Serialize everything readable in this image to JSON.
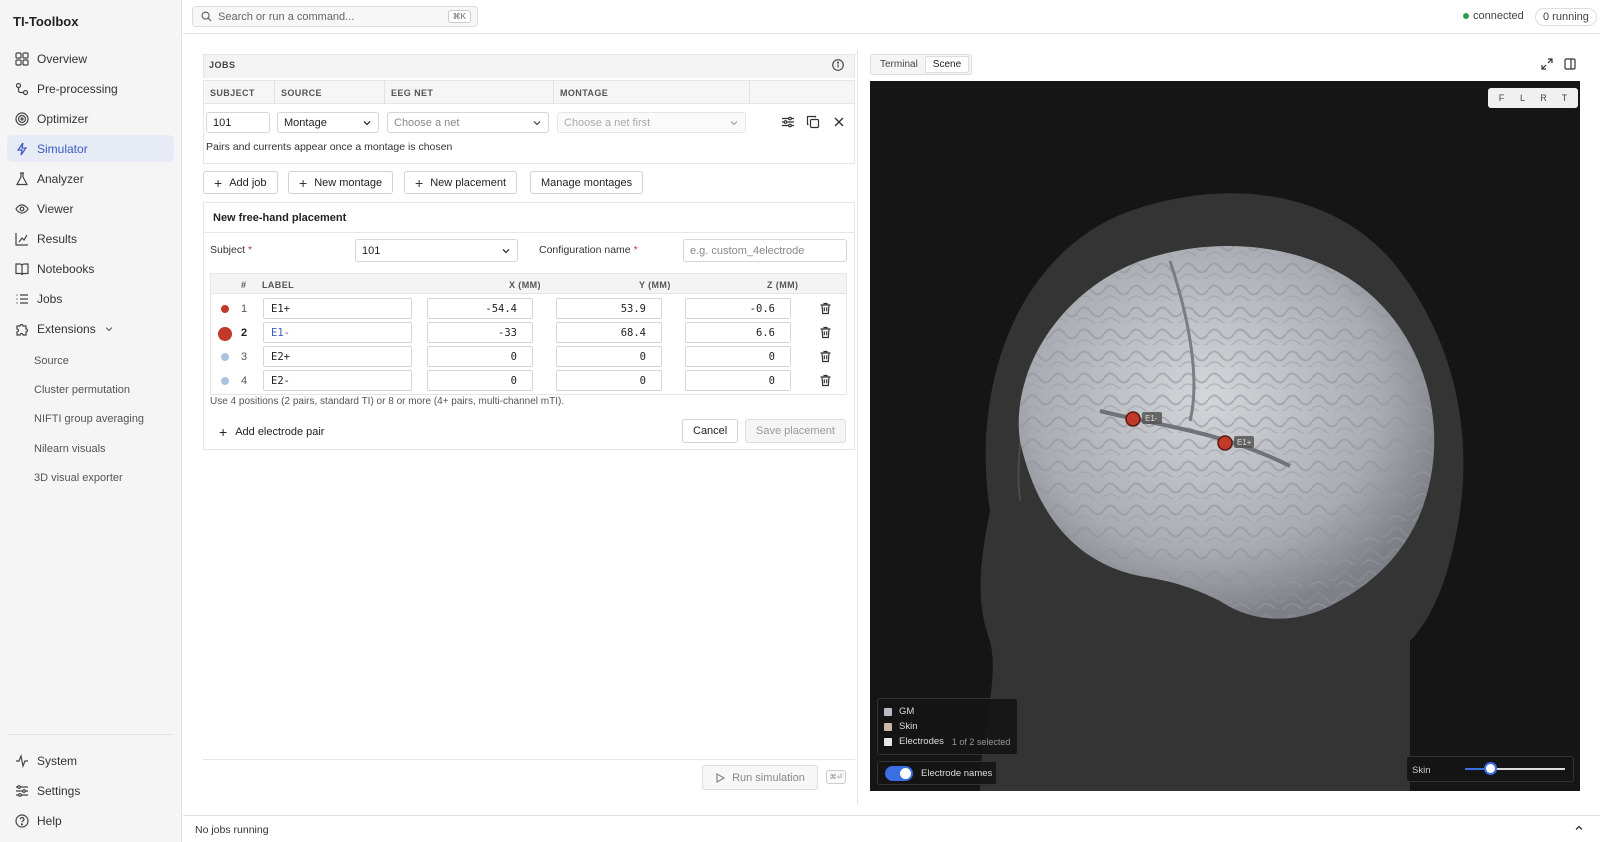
{
  "app": {
    "title": "TI-Toolbox"
  },
  "sidebar": {
    "items": [
      {
        "label": "Overview",
        "icon": "grid-icon"
      },
      {
        "label": "Pre-processing",
        "icon": "workflow-icon"
      },
      {
        "label": "Optimizer",
        "icon": "target-icon"
      },
      {
        "label": "Simulator",
        "icon": "bolt-icon",
        "active": true
      },
      {
        "label": "Analyzer",
        "icon": "flask-icon"
      },
      {
        "label": "Viewer",
        "icon": "eye-icon"
      },
      {
        "label": "Results",
        "icon": "chart-icon"
      },
      {
        "label": "Notebooks",
        "icon": "book-icon"
      },
      {
        "label": "Jobs",
        "icon": "list-icon"
      },
      {
        "label": "Extensions",
        "icon": "puzzle-icon"
      }
    ],
    "extensions": [
      "Source",
      "Cluster permutation",
      "NIFTI group averaging",
      "Nilearn visuals",
      "3D visual exporter"
    ],
    "footer": [
      {
        "label": "System",
        "icon": "activity-icon"
      },
      {
        "label": "Settings",
        "icon": "sliders-icon"
      },
      {
        "label": "Help",
        "icon": "help-icon"
      }
    ]
  },
  "topbar": {
    "search_placeholder": "Search or run a command...",
    "search_shortcut": "⌘K",
    "status": "connected",
    "running": "0 running"
  },
  "jobs": {
    "title": "JOBS",
    "columns": [
      "SUBJECT",
      "SOURCE",
      "EEG NET",
      "MONTAGE"
    ],
    "row": {
      "subject": "101",
      "source": "Montage",
      "eeg_net_placeholder": "Choose a net",
      "montage_placeholder": "Choose a net first"
    },
    "hint": "Pairs and currents appear once a montage is chosen"
  },
  "actions": {
    "add_job": "Add job",
    "new_montage": "New montage",
    "new_placement": "New placement",
    "manage_montages": "Manage montages"
  },
  "placement": {
    "title": "New free-hand placement",
    "subject_label": "Subject",
    "subject_value": "101",
    "config_label": "Configuration name",
    "config_placeholder": "e.g. custom_4electrode",
    "table_headers": [
      "#",
      "LABEL",
      "X (MM)",
      "Y (MM)",
      "Z (MM)"
    ],
    "rows": [
      {
        "num": "1",
        "label": "E1+",
        "x": "-54.4",
        "y": "53.9",
        "z": "-0.6",
        "color": "#c0392b"
      },
      {
        "num": "2",
        "label": "E1-",
        "x": "-33",
        "y": "68.4",
        "z": "6.6",
        "color": "#c0392b",
        "selected": true
      },
      {
        "num": "3",
        "label": "E2+",
        "x": "0",
        "y": "0",
        "z": "0",
        "color": "#a9c4e0"
      },
      {
        "num": "4",
        "label": "E2-",
        "x": "0",
        "y": "0",
        "z": "0",
        "color": "#a9c4e0"
      }
    ],
    "hint": "Use 4 positions (2 pairs, standard TI) or 8 or more (4+ pairs, multi-channel mTI).",
    "add_pair": "Add electrode pair",
    "cancel": "Cancel",
    "save": "Save placement"
  },
  "run": {
    "label": "Run simulation",
    "shortcut": "⌘⏎"
  },
  "viewer": {
    "tabs": [
      "Terminal",
      "Scene"
    ],
    "active_tab": "Scene",
    "view_buttons": [
      "F",
      "L",
      "R",
      "T"
    ],
    "electrode_labels": [
      "E1-",
      "E1+"
    ],
    "legend": [
      {
        "label": "GM",
        "color": "#b8bcc4"
      },
      {
        "label": "Skin",
        "color": "#c9b8a8"
      },
      {
        "label": "Electrodes",
        "color": "#e8e8e8",
        "sub": "1 of 2 selected"
      }
    ],
    "names_toggle": "Electrode names",
    "names_toggle_on": true,
    "skin_label": "Skin",
    "skin_opacity": 0.26
  },
  "statusbar": {
    "text": "No jobs running"
  }
}
